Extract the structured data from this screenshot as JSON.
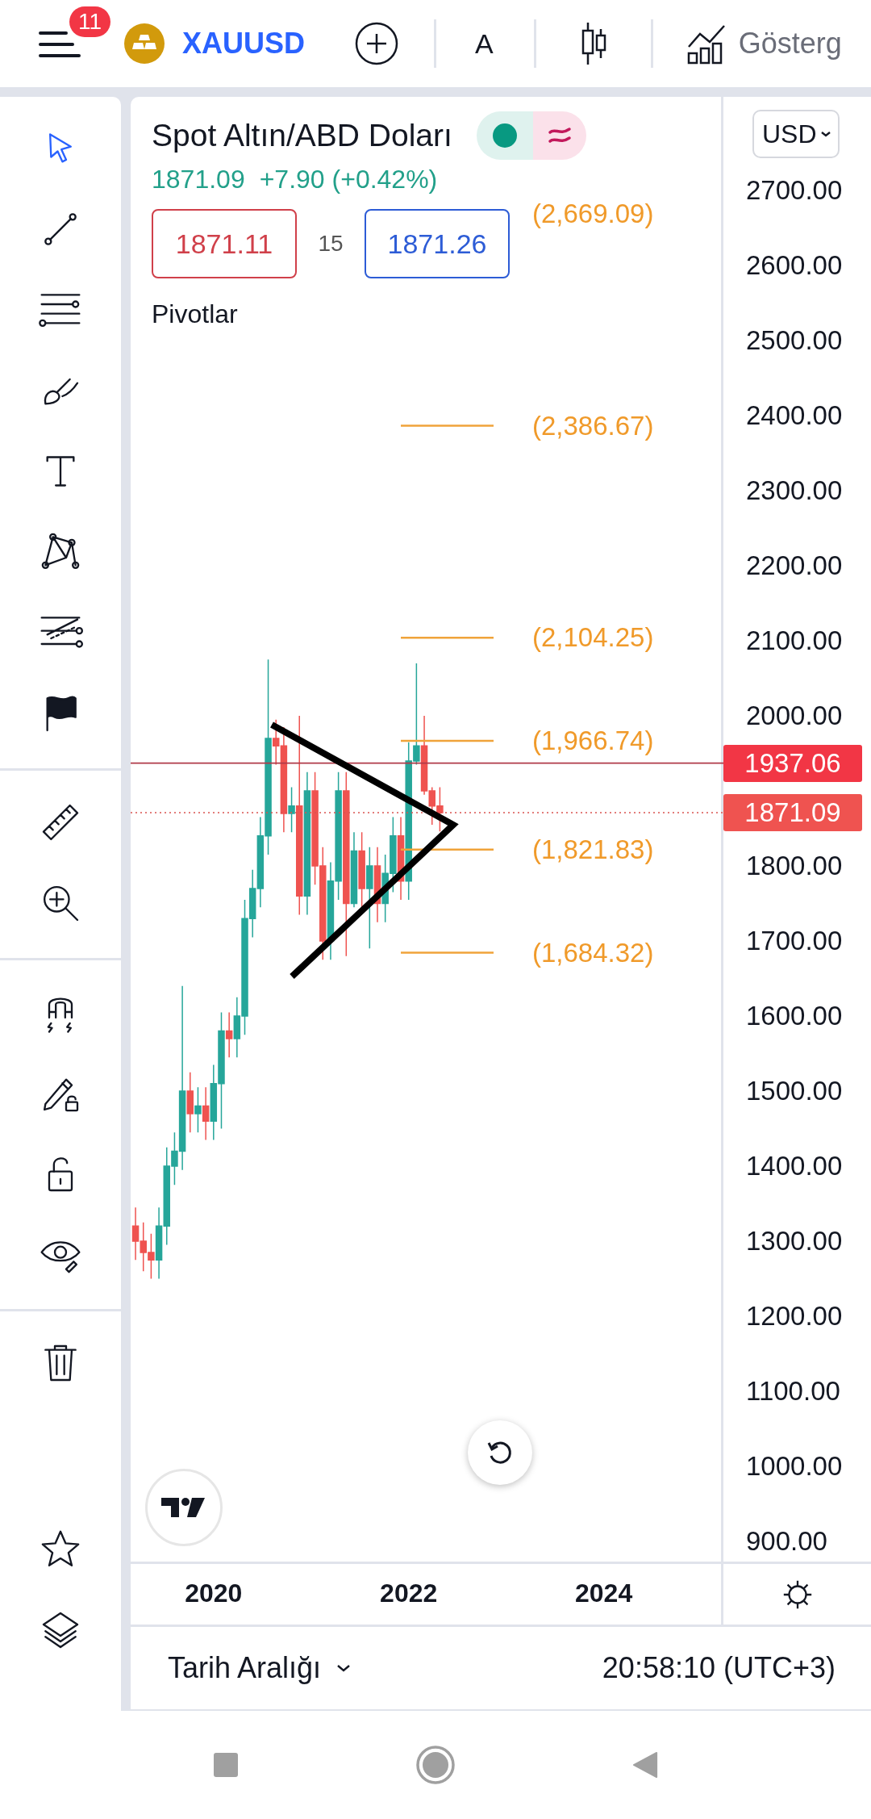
{
  "top_bar": {
    "notification_count": "11",
    "symbol": "XAUUSD",
    "interval": "A",
    "indicators_label": "Gösterg"
  },
  "tool_groups": [
    [
      {
        "kind": "cursor",
        "selected": true
      },
      {
        "kind": "trend-line",
        "selected": false
      },
      {
        "kind": "fib",
        "selected": false
      },
      {
        "kind": "brush",
        "selected": false
      },
      {
        "kind": "text",
        "selected": false
      },
      {
        "kind": "pattern",
        "selected": false
      },
      {
        "kind": "forecast",
        "selected": false
      },
      {
        "kind": "flag",
        "selected": false
      }
    ],
    [
      {
        "kind": "ruler",
        "selected": false
      },
      {
        "kind": "zoom",
        "selected": false
      }
    ],
    [
      {
        "kind": "magnet",
        "selected": false
      },
      {
        "kind": "pencil-lock",
        "selected": false
      },
      {
        "kind": "lock",
        "selected": false
      },
      {
        "kind": "eye",
        "selected": false
      }
    ],
    [
      {
        "kind": "trash",
        "selected": false
      }
    ],
    [
      {
        "kind": "star",
        "selected": false
      },
      {
        "kind": "layers",
        "selected": false
      }
    ]
  ],
  "legend": {
    "title": "Spot Altın/ABD Doları",
    "last": "1871.09",
    "change": "+7.90 (+0.42%)",
    "sell": "1871.11",
    "spread": "15",
    "buy": "1871.26",
    "indicator": "Pivotlar"
  },
  "currency": "USD",
  "pivot_levels": [
    "(2,669.09)",
    "(2,386.67)",
    "(2,104.25)",
    "(1,966.74)",
    "(1,821.83)",
    "(1,684.32)"
  ],
  "price_tags": [
    {
      "label": "1937.06",
      "kind": "solid"
    },
    {
      "label": "1871.09",
      "kind": "dotted"
    }
  ],
  "chart_data": {
    "type": "candlestick",
    "x": [
      2019.2,
      2019.28,
      2019.36,
      2019.44,
      2019.52,
      2019.6,
      2019.68,
      2019.76,
      2019.84,
      2019.92,
      2020,
      2020.08,
      2020.16,
      2020.24,
      2020.32,
      2020.4,
      2020.48,
      2020.56,
      2020.64,
      2020.72,
      2020.8,
      2020.88,
      2020.96,
      2021.04,
      2021.12,
      2021.2,
      2021.28,
      2021.36,
      2021.44,
      2021.52,
      2021.6,
      2021.68,
      2021.76,
      2021.84,
      2021.92,
      2022,
      2022.08,
      2022.16,
      2022.24,
      2022.32
    ],
    "xticks": [
      2020,
      2022,
      2024
    ],
    "yticks": [
      {
        "value": 2700,
        "label": "2700.00"
      },
      {
        "value": 2600,
        "label": "2600.00"
      },
      {
        "value": 2500,
        "label": "2500.00"
      },
      {
        "value": 2400,
        "label": "2400.00"
      },
      {
        "value": 2300,
        "label": "2300.00"
      },
      {
        "value": 2200,
        "label": "2200.00"
      },
      {
        "value": 2100,
        "label": "2100.00"
      },
      {
        "value": 2000,
        "label": "2000.00"
      },
      {
        "value": 1800,
        "label": "1800.00"
      },
      {
        "value": 1700,
        "label": "1700.00"
      },
      {
        "value": 1600,
        "label": "1600.00"
      },
      {
        "value": 1500,
        "label": "1500.00"
      },
      {
        "value": 1400,
        "label": "1400.00"
      },
      {
        "value": 1300,
        "label": "1300.00"
      },
      {
        "value": 1200,
        "label": "1200.00"
      },
      {
        "value": 1100,
        "label": "1100.00"
      },
      {
        "value": 1000,
        "label": "1000.00"
      },
      {
        "value": 900,
        "label": "900.00"
      }
    ],
    "xlim": [
      2019.15,
      2026.74
    ],
    "ohlc": [
      [
        1320,
        1345,
        1275,
        1300
      ],
      [
        1300,
        1325,
        1260,
        1285
      ],
      [
        1285,
        1310,
        1250,
        1275
      ],
      [
        1275,
        1345,
        1250,
        1320
      ],
      [
        1320,
        1425,
        1295,
        1400
      ],
      [
        1400,
        1445,
        1375,
        1420
      ],
      [
        1420,
        1640,
        1395,
        1500
      ],
      [
        1500,
        1525,
        1445,
        1470
      ],
      [
        1470,
        1505,
        1445,
        1480
      ],
      [
        1480,
        1505,
        1435,
        1460
      ],
      [
        1460,
        1535,
        1435,
        1510
      ],
      [
        1510,
        1605,
        1450,
        1580
      ],
      [
        1580,
        1605,
        1545,
        1570
      ],
      [
        1570,
        1625,
        1545,
        1600
      ],
      [
        1600,
        1755,
        1575,
        1730
      ],
      [
        1730,
        1795,
        1705,
        1770
      ],
      [
        1770,
        1865,
        1745,
        1840
      ],
      [
        1840,
        2075,
        1815,
        1970
      ],
      [
        1970,
        1995,
        1935,
        1960
      ],
      [
        1960,
        1985,
        1845,
        1870
      ],
      [
        1870,
        1905,
        1845,
        1880
      ],
      [
        1880,
        2000,
        1735,
        1760
      ],
      [
        1760,
        1925,
        1735,
        1900
      ],
      [
        1900,
        1925,
        1775,
        1800
      ],
      [
        1800,
        1825,
        1675,
        1700
      ],
      [
        1700,
        1805,
        1675,
        1780
      ],
      [
        1780,
        1925,
        1755,
        1900
      ],
      [
        1900,
        1925,
        1680,
        1750
      ],
      [
        1750,
        1845,
        1745,
        1820
      ],
      [
        1820,
        1845,
        1745,
        1770
      ],
      [
        1770,
        1825,
        1690,
        1800
      ],
      [
        1800,
        1825,
        1725,
        1750
      ],
      [
        1750,
        1815,
        1725,
        1790
      ],
      [
        1790,
        1865,
        1765,
        1840
      ],
      [
        1840,
        1865,
        1755,
        1780
      ],
      [
        1780,
        1965,
        1755,
        1940
      ],
      [
        1940,
        2070,
        1935,
        1960
      ],
      [
        1960,
        2000,
        1895,
        1900
      ],
      [
        1900,
        1905,
        1855,
        1880
      ],
      [
        1880,
        1905,
        1846,
        1871
      ]
    ],
    "ylim": [
      873,
      2825
    ]
  },
  "footer": {
    "range_label": "Tarih Aralığı",
    "clock": "20:58:10 (UTC+3)"
  }
}
